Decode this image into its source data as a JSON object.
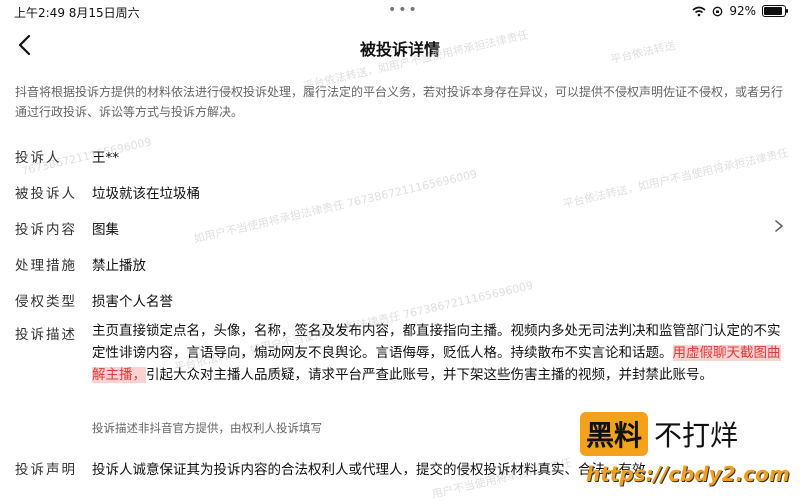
{
  "statusbar": {
    "time_date": "上午2:49   8月15日周六",
    "battery_percent": "92%"
  },
  "header": {
    "title": "被投诉详情"
  },
  "intro_text": "抖音将根据投诉方提供的材料依法进行侵权投诉处理，履行法定的平台义务，若对投诉本身存在异议，可以提供不侵权声明佐证不侵权，或者另行通过行政投诉、诉讼等方式与投诉方解决。",
  "fields": {
    "complainant": {
      "label": "投诉人",
      "value": "王**"
    },
    "respondent": {
      "label": "被投诉人",
      "value": "垃圾就该在垃圾桶"
    },
    "content": {
      "label": "投诉内容",
      "value": "图集"
    },
    "measure": {
      "label": "处理措施",
      "value": "禁止播放"
    },
    "type": {
      "label": "侵权类型",
      "value": "损害个人名誉"
    },
    "description": {
      "label": "投诉描述",
      "part1": "主页直接锁定点名，头像，名称，签名及发布内容，都直接指向主播。视频内多处无司法判决和监管部门认定的不实定性诽谤内容，言语导向，煽动网友不良舆论。言语侮辱，贬低人格。持续散布不实言论和话题。",
      "highlight": "用虚假聊天截图曲解主播，",
      "part2": "引起大众对主播人品质疑，请求平台严查此账号，并下架这些伤害主播的视频，并封禁此账号。"
    },
    "source_note": "投诉描述非抖音官方提供，由权利人投诉填写",
    "statement": {
      "label": "投诉声明",
      "value": "投诉人诚意保证其为投诉内容的合法权利人或代理人，提交的侵权投诉材料真实、合法、有效"
    }
  },
  "watermarks": [
    "平台依法转送，如用户不当使用将承担法律责任",
    "平台依法转送",
    "7673867211165696009",
    "如用户不当使用将承担法律责任 7673867211165696009",
    "平台依法转送，如用户不当使用将承担法律责任",
    "平台依法转送，如用户不当使用将承担法律责任 7673867211165696009",
    "用户不当使用将承担法律责任"
  ],
  "brand": {
    "main": "黑料",
    "side": "不打烊",
    "url": "https://cbdy2.com"
  },
  "colors": {
    "highlight_bg": "#fbd2d2",
    "highlight_text": "#e03b3b",
    "brand_orange": "#f2a21b"
  }
}
